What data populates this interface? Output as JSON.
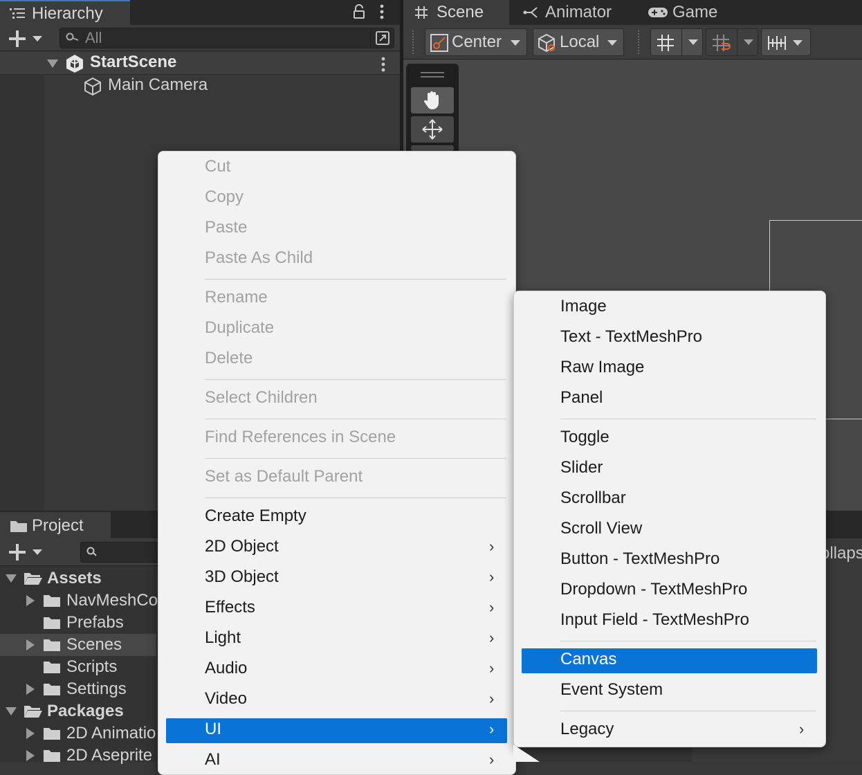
{
  "hierarchy": {
    "tab_label": "Hierarchy",
    "search_placeholder": "All",
    "scene_name": "StartScene",
    "children": [
      "Main Camera"
    ]
  },
  "scene_tabs": [
    {
      "label": "Scene",
      "icon": "hash-icon"
    },
    {
      "label": "Animator",
      "icon": "animator-icon"
    },
    {
      "label": "Game",
      "icon": "gamepad-icon"
    }
  ],
  "scene_toolbar": {
    "pivot_label": "Center",
    "space_label": "Local"
  },
  "project": {
    "tab_label": "Project",
    "right_partial_text": "ollaps",
    "tree": [
      {
        "label": "Assets",
        "level": 0,
        "expanded": true
      },
      {
        "label": "NavMeshCo",
        "level": 1,
        "arrow": true
      },
      {
        "label": "Prefabs",
        "level": 1,
        "arrow": false
      },
      {
        "label": "Scenes",
        "level": 1,
        "arrow": true,
        "selected": true
      },
      {
        "label": "Scripts",
        "level": 1,
        "arrow": false
      },
      {
        "label": "Settings",
        "level": 1,
        "arrow": true
      },
      {
        "label": "Packages",
        "level": 0,
        "expanded": true
      },
      {
        "label": "2D Animatio",
        "level": 1,
        "arrow": true
      },
      {
        "label": "2D Aseprite",
        "level": 1,
        "arrow": true
      }
    ]
  },
  "context_menu": {
    "groups": [
      [
        "Cut",
        "Copy",
        "Paste",
        "Paste As Child"
      ],
      [
        "Rename",
        "Duplicate",
        "Delete"
      ],
      [
        "Select Children"
      ],
      [
        "Find References in Scene"
      ],
      [
        "Set as Default Parent"
      ]
    ],
    "create_items": [
      {
        "label": "Create Empty",
        "submenu": false
      },
      {
        "label": "2D Object",
        "submenu": true
      },
      {
        "label": "3D Object",
        "submenu": true
      },
      {
        "label": "Effects",
        "submenu": true
      },
      {
        "label": "Light",
        "submenu": true
      },
      {
        "label": "Audio",
        "submenu": true
      },
      {
        "label": "Video",
        "submenu": true
      },
      {
        "label": "UI",
        "submenu": true,
        "highlighted": true
      },
      {
        "label": "AI",
        "submenu": true
      }
    ]
  },
  "ui_submenu": {
    "groups": [
      [
        "Image",
        "Text - TextMeshPro",
        "Raw Image",
        "Panel"
      ],
      [
        "Toggle",
        "Slider",
        "Scrollbar",
        "Scroll View",
        "Button - TextMeshPro",
        "Dropdown - TextMeshPro",
        "Input Field - TextMeshPro"
      ],
      [
        "Canvas",
        "Event System"
      ]
    ],
    "highlighted": "Canvas",
    "legacy_label": "Legacy"
  },
  "colors": {
    "highlight": "#0a73d6",
    "menu_bg": "#f2f2f2",
    "disabled_text": "#a2a2a2",
    "editor_bg": "#383838"
  }
}
